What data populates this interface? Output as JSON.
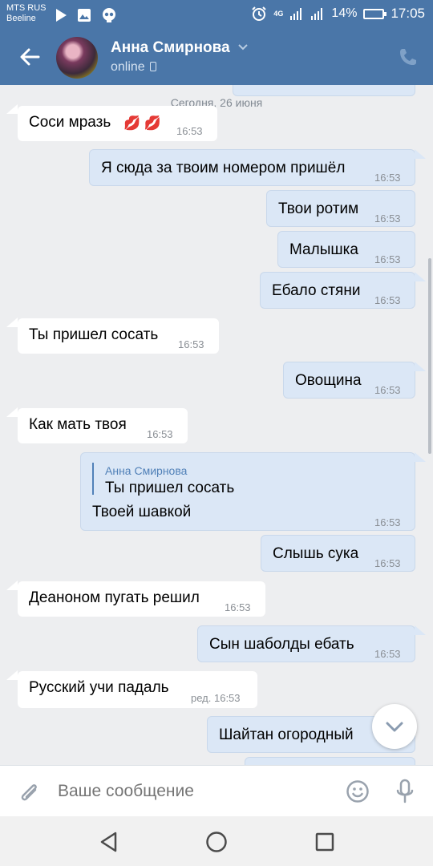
{
  "status_bar": {
    "carrier_1": "MTS RUS",
    "carrier_2": "Beeline",
    "network": "4G",
    "battery": "14%",
    "time": "17:05"
  },
  "header": {
    "contact_name": "Анна Смирнова",
    "status": "online"
  },
  "chat": {
    "date_separator": "Сегодня, 26 июня",
    "messages": [
      {
        "dir": "in",
        "text": "Соси мразь",
        "time": "16:53"
      },
      {
        "dir": "out",
        "text": "Я сюда за твоим номером пришёл",
        "time": "16:53"
      },
      {
        "dir": "out",
        "text": "Твои ротим",
        "time": "16:53"
      },
      {
        "dir": "out",
        "text": "Малышка",
        "time": "16:53"
      },
      {
        "dir": "out",
        "text": "Ебало стяни",
        "time": "16:53"
      },
      {
        "dir": "in",
        "text": "Ты пришел сосать",
        "time": "16:53"
      },
      {
        "dir": "out",
        "text": "Овощина",
        "time": "16:53"
      },
      {
        "dir": "in",
        "text": "Как мать твоя",
        "time": "16:53"
      },
      {
        "dir": "out",
        "reply_author": "Анна Смирнова",
        "reply_text": "Ты пришел сосать",
        "text": "Твоей шавкой",
        "time": "16:53"
      },
      {
        "dir": "out",
        "text": "Слышь сука",
        "time": "16:53"
      },
      {
        "dir": "in",
        "text": "Деаноном пугать решил",
        "time": "16:53"
      },
      {
        "dir": "out",
        "text": "Сын шаболды ебать",
        "time": "16:53"
      },
      {
        "dir": "in",
        "text": "Русский учи падаль",
        "time": "ред. 16:53"
      },
      {
        "dir": "out",
        "text": "Шайтан огородный",
        "time": ""
      },
      {
        "dir": "out",
        "text": "",
        "time": ""
      }
    ]
  },
  "composer": {
    "placeholder": "Ваше сообщение"
  },
  "colors": {
    "header": "#4a76a8",
    "outgoing_bubble": "#dbe7f6",
    "incoming_bubble": "#ffffff",
    "chat_background": "#edeef0",
    "reply_accent": "#5181b8"
  },
  "icons": [
    "play-icon",
    "image-icon",
    "skull-icon",
    "alarm-icon",
    "signal-icon",
    "battery-icon",
    "back-arrow-icon",
    "chevron-down-icon",
    "phone-icon",
    "call-icon",
    "kiss-icon",
    "scroll-down-icon",
    "paperclip-icon",
    "smile-icon",
    "mic-icon",
    "nav-back-icon",
    "nav-home-icon",
    "nav-recent-icon"
  ]
}
